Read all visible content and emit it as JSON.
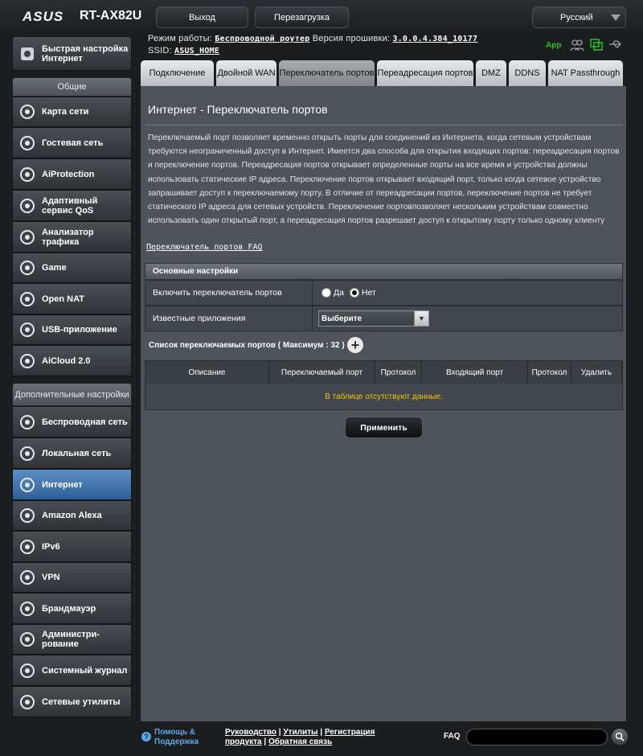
{
  "header": {
    "logo": "ASUS",
    "model": "RT-AX82U",
    "logout": "Выход",
    "reboot": "Перезагрузка",
    "language": "Русский"
  },
  "info": {
    "mode_label": "Режим работы:",
    "mode_value": "Беспроводной роутер",
    "fw_label": "Версия прошивки:",
    "fw_value": "3.0.0.4.384_10177",
    "ssid_label": "SSID:",
    "ssid_value": "ASUS_HOME",
    "app_label": "App"
  },
  "sidebar": {
    "quick_setup": "Быстрая настройка Интернет",
    "general_header": "Общие",
    "general": [
      {
        "label": "Карта сети",
        "icon": "network-map-icon"
      },
      {
        "label": "Гостевая сеть",
        "icon": "guest-network-icon"
      },
      {
        "label": "AiProtection",
        "icon": "aiprotection-icon"
      },
      {
        "label": "Адаптивный сервис QoS",
        "icon": "qos-icon"
      },
      {
        "label": "Анализатор трафика",
        "icon": "traffic-analyzer-icon"
      },
      {
        "label": "Game",
        "icon": "gamepad-icon"
      },
      {
        "label": "Open NAT",
        "icon": "open-nat-icon"
      },
      {
        "label": "USB-приложение",
        "icon": "usb-icon"
      },
      {
        "label": "AiCloud 2.0",
        "icon": "cloud-icon"
      }
    ],
    "advanced_header": "Дополнительные настройки",
    "advanced": [
      {
        "label": "Беспроводная сеть",
        "icon": "wireless-icon"
      },
      {
        "label": "Локальная сеть",
        "icon": "lan-icon"
      },
      {
        "label": "Интернет",
        "icon": "globe-icon"
      },
      {
        "label": "Amazon Alexa",
        "icon": "alexa-icon"
      },
      {
        "label": "IPv6",
        "icon": "ipv6-icon"
      },
      {
        "label": "VPN",
        "icon": "vpn-icon"
      },
      {
        "label": "Брандмауэр",
        "icon": "firewall-icon"
      },
      {
        "label": "Администри-рование",
        "icon": "admin-icon"
      },
      {
        "label": "Системный журнал",
        "icon": "syslog-icon"
      },
      {
        "label": "Сетевые утилиты",
        "icon": "gear-icon"
      }
    ]
  },
  "tabs": [
    "Подключение",
    "Двойной WAN",
    "Переключатель портов",
    "Переадресация портов",
    "DMZ",
    "DDNS",
    "NAT Passthrough"
  ],
  "page": {
    "title": "Интернет - Переключатель портов",
    "description": "Переключаемый порт позволяет временно открыть порты для соединений из Интернета, когда сетевым устройствам требуются неограниченный доступ в Интернет. Имеется два способа для открытия входящих портов: переадресация портов и переключение портов. Переадресация портов открывает определенные порты на все время и устройства должны использовать статические IP адреса. Переключение портов открывает входящий порт, только когда сетевое устройство запрашивает доступ к переключаемому порту. В отличие от переадресации портов, переключение портов не требует статического IP адреса для сетевых устройств. Переключение портовпозволяет нескольким устройствам совместно использовать один открытый порт, а переадресация портов разрешает доступ к открытому порту только одному клиенту",
    "faq_link": "Переключатель портов FAQ",
    "basic_header": "Основные настройки",
    "enable_label": "Включить переключатель портов",
    "yes": "Да",
    "no": "Нет",
    "enabled": false,
    "known_apps_label": "Известные приложения",
    "known_apps_value": "Выберите",
    "list_label": "Список переключаемых портов ( Максимум : 32 )",
    "columns": [
      "Описание",
      "Переключаемый порт",
      "Протокол",
      "Входящий порт",
      "Протокол",
      "Удалить"
    ],
    "empty_msg": "В таблице отсутствуют данные.",
    "apply": "Применить"
  },
  "footer": {
    "help": "Помощь & Поддержка",
    "manual": "Руководство",
    "utilities": "Утилиты",
    "registration": "Регистрация продукта",
    "feedback": "Обратная связь",
    "faq": "FAQ"
  }
}
